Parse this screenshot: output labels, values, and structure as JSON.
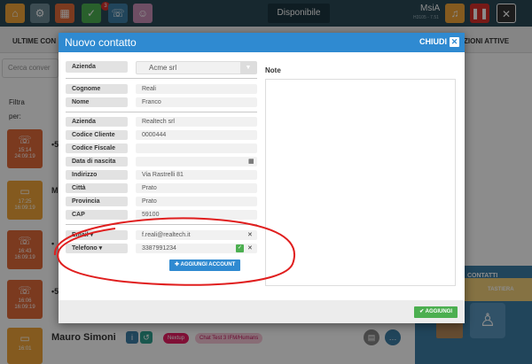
{
  "topbar": {
    "icons": [
      "home-icon",
      "gear-icon",
      "calendar-icon",
      "check-icon",
      "phone-agent-icon",
      "contacts-icon"
    ],
    "badge_count": "3",
    "status_label": "Disponibile",
    "user_name": "MsiA",
    "user_version": "H3105 - 7.51",
    "right_icons": [
      "bell-icon",
      "pause-icon",
      "close-icon"
    ],
    "colors": {
      "bar": "#2b4a57",
      "home": "#f0a53a",
      "gear": "#6d8a96",
      "calendar": "#e06a3a",
      "check": "#4caf50",
      "phone": "#3d7ea6",
      "contacts": "#c98fb6"
    }
  },
  "background": {
    "tab_left": "ULTIME CON",
    "tab_right": "ZIONI ATTIVE",
    "search_placeholder": "Cerca conver",
    "filter_label": "Filtra",
    "per_label": "per:",
    "conversations": [
      {
        "type": "phone",
        "time": "15:14",
        "date": "24:09:19",
        "initial": "•5"
      },
      {
        "type": "chat",
        "time": "17:25",
        "date": "16:09:19",
        "initial": "M"
      },
      {
        "type": "phone",
        "time": "16:43",
        "date": "16:09:19",
        "initial": "•"
      },
      {
        "type": "phone",
        "time": "16:06",
        "date": "16:09:19",
        "initial": "•5"
      },
      {
        "type": "chat",
        "time": "16:01",
        "date": "",
        "initial": ""
      }
    ],
    "bottom_contact": "Mauro Simoni",
    "tags": [
      "Nextup",
      "Chat Test 3 IFM/Humans"
    ],
    "right_panel": {
      "contatti": "CONTATTI",
      "no_label": "NO",
      "tastiera": "TASTIERA"
    }
  },
  "modal": {
    "title": "Nuovo contatto",
    "close_label": "CHIUDI",
    "azienda_label": "Azienda",
    "azienda_value": "Acme srl",
    "fields": [
      {
        "label": "Cognome",
        "value": "Reali"
      },
      {
        "label": "Nome",
        "value": "Franco"
      }
    ],
    "company_fields": [
      {
        "label": "Azienda",
        "value": "Realtech srl"
      },
      {
        "label": "Codice Cliente",
        "value": "0000444"
      },
      {
        "label": "Codice Fiscale",
        "value": ""
      },
      {
        "label": "Data di nascita",
        "value": ""
      },
      {
        "label": "Indirizzo",
        "value": "Via Rastrelli  81"
      },
      {
        "label": "Città",
        "value": "Prato"
      },
      {
        "label": "Provincia",
        "value": "Prato"
      },
      {
        "label": "CAP",
        "value": "59100"
      }
    ],
    "accounts": [
      {
        "label": "Email",
        "value": "f.reali@realtech.it"
      },
      {
        "label": "Telefono",
        "value": "3387991234"
      }
    ],
    "add_account_label": "AGGIUNGI ACCOUNT",
    "note_label": "Note",
    "note_value": "",
    "submit_label": "AGGIUNGI"
  }
}
